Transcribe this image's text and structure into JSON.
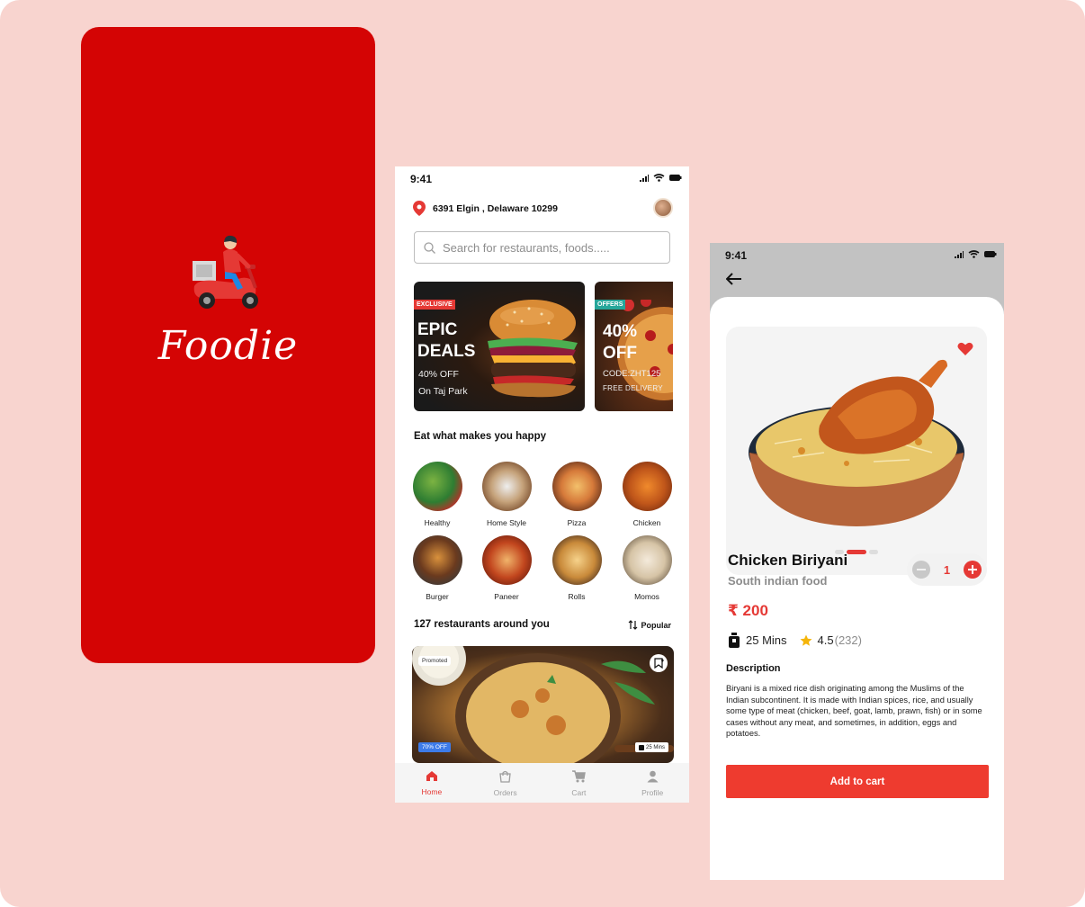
{
  "splash": {
    "brand": "Foodie",
    "logo_icon": "delivery-scooter-icon",
    "bg_color": "#d40404"
  },
  "home": {
    "status_time": "9:41",
    "location": "6391 Elgin , Delaware 10299",
    "search_placeholder": "Search for restaurants, foods.....",
    "banners": [
      {
        "tag": "EXCLUSIVE",
        "title_line1": "EPIC",
        "title_line2": "DEALS",
        "line3": "40% OFF",
        "line4": "On Taj Park"
      },
      {
        "tag": "OFFERS",
        "title_line1": "40%",
        "title_line2": "OFF",
        "line3": "CODE:ZHT125",
        "line4": "FREE DELIVERY"
      }
    ],
    "categories_title": "Eat what makes you happy",
    "categories": [
      "Healthy",
      "Home Style",
      "Pizza",
      "Chicken",
      "Burger",
      "Paneer",
      "Rolls",
      "Momos"
    ],
    "restaurants_title": "127 restaurants around you",
    "sort_label": "Popular",
    "restaurant_card": {
      "promoted": "Promoted",
      "offer": "70% OFF",
      "time": "25 Mins"
    },
    "tabs": [
      {
        "label": "Home",
        "icon": "home-icon",
        "active": true
      },
      {
        "label": "Orders",
        "icon": "bag-icon",
        "active": false
      },
      {
        "label": "Cart",
        "icon": "cart-icon",
        "active": false
      },
      {
        "label": "Profile",
        "icon": "person-icon",
        "active": false
      }
    ]
  },
  "detail": {
    "status_time": "9:41",
    "dish_name": "Chicken Biriyani",
    "dish_sub": "South indian food",
    "quantity": "1",
    "price": "₹ 200",
    "time": "25 Mins",
    "rating": "4.5",
    "rating_count": "(232)",
    "description_title": "Description",
    "description": "Biryani  is a mixed rice dish originating among the Muslims of the Indian subcontinent. It is made with Indian spices, rice, and usually some type of meat (chicken, beef, goat, lamb, prawn, fish) or in some cases without any meat, and sometimes, in addition, eggs and potatoes.",
    "add_to_cart": "Add to cart",
    "favorite": true,
    "carousel_active_index": 1
  },
  "colors": {
    "accent": "#e53935",
    "page_bg": "#f8d4cf",
    "button": "#ee3b2f"
  }
}
